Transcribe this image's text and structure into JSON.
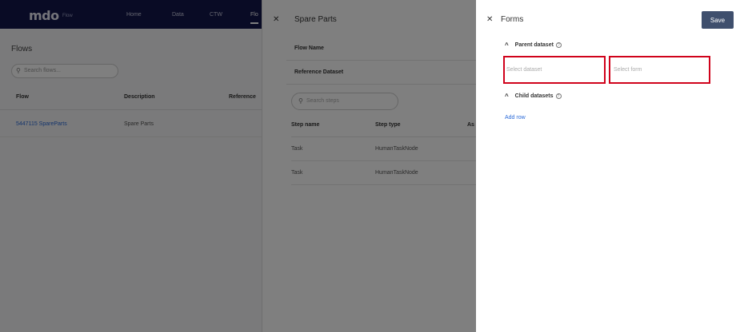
{
  "base": {
    "logo": "mdo",
    "logo_sub": "Flow",
    "nav": [
      "Home",
      "Data",
      "CTW",
      "Flo"
    ],
    "title": "Flows",
    "search_placeholder": "Search flows...",
    "columns": [
      "Flow",
      "Description",
      "Reference"
    ],
    "row": {
      "flow": "5447115 SpareParts",
      "description": "Spare Parts"
    }
  },
  "spare_parts": {
    "title": "Spare Parts",
    "fields": [
      "Flow Name",
      "Reference Dataset"
    ],
    "search_placeholder": "Search steps",
    "columns": [
      "Step name",
      "Step type",
      "As"
    ],
    "rows": [
      {
        "name": "Task",
        "type": "HumanTaskNode"
      },
      {
        "name": "Task",
        "type": "HumanTaskNode"
      }
    ]
  },
  "forms": {
    "title": "Forms",
    "save_label": "Save",
    "parent_label": "Parent dataset",
    "dataset_placeholder": "Select dataset",
    "form_placeholder": "Select form",
    "child_label": "Child datasets",
    "add_row_label": "Add row"
  },
  "icons": {
    "close": "close-icon",
    "chevron": "chevron-up-icon",
    "help": "help-icon",
    "search": "search-icon"
  },
  "colors": {
    "topbar": "#12164a",
    "save": "#3f4f6d",
    "highlight": "#d0021b",
    "link": "#2a6ad8"
  }
}
